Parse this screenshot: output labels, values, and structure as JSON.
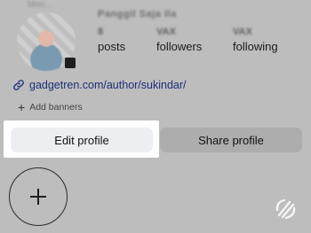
{
  "profile": {
    "avatar_caption": "Moo...",
    "display_name": "Panggil Saja Ila",
    "stats": [
      {
        "count": "8",
        "label": "posts"
      },
      {
        "count": "VAX",
        "label": "followers"
      },
      {
        "count": "VAX",
        "label": "following"
      }
    ]
  },
  "link": {
    "url_text": "gadgetren.com/author/sukindar/",
    "icon": "link-icon"
  },
  "banners": {
    "label": "Add banners",
    "icon": "plus-icon"
  },
  "actions": {
    "edit_label": "Edit profile",
    "share_label": "Share profile"
  },
  "highlights": {
    "new_icon": "plus-icon"
  },
  "watermark": {
    "icon": "gadgetren-logo-icon"
  },
  "colors": {
    "overlay": "#bdbdbd",
    "highlight_frame": "#ffffff",
    "edit_button": "#eceef1",
    "share_button": "#adadad",
    "link": "#1c2f7a"
  }
}
